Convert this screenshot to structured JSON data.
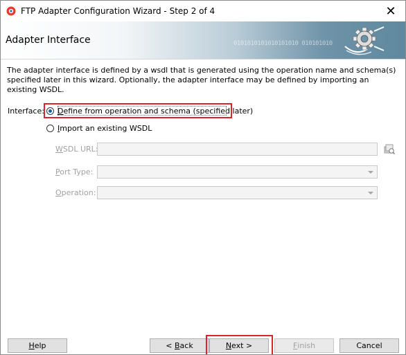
{
  "window": {
    "title": "FTP Adapter Configuration Wizard - Step 2 of 4",
    "close_glyph": "✕"
  },
  "banner": {
    "title": "Adapter Interface",
    "binary_text": "0101010101010101010 010101010"
  },
  "content": {
    "description": "The adapter interface is defined by a wsdl that is generated using the operation name and schema(s) specified later in this wizard.  Optionally, the adapter interface may be defined by importing an existing WSDL.",
    "interface_label": "Interface:",
    "options": [
      {
        "label_first": "D",
        "label_rest": "efine from operation and schema (specified later)",
        "selected": true
      },
      {
        "label_first": "I",
        "label_rest": "mport an existing WSDL",
        "selected": false
      }
    ],
    "fields": {
      "wsdl_url": {
        "label_first": "W",
        "label_rest": "SDL URL:",
        "value": ""
      },
      "port_type": {
        "label_first": "P",
        "label_rest": "ort Type:",
        "value": ""
      },
      "operation": {
        "label_first": "O",
        "label_rest": "peration:",
        "value": ""
      }
    }
  },
  "buttons": {
    "help": {
      "first": "H",
      "rest": "elp"
    },
    "back": {
      "prefix": "< ",
      "first": "B",
      "rest": "ack"
    },
    "next": {
      "first": "N",
      "rest": "ext >"
    },
    "finish": {
      "first": "F",
      "rest": "inish"
    },
    "cancel": {
      "label": "Cancel"
    }
  },
  "colors": {
    "highlight_red": "#d9232d",
    "radio_selected": "#1c5fb8"
  }
}
